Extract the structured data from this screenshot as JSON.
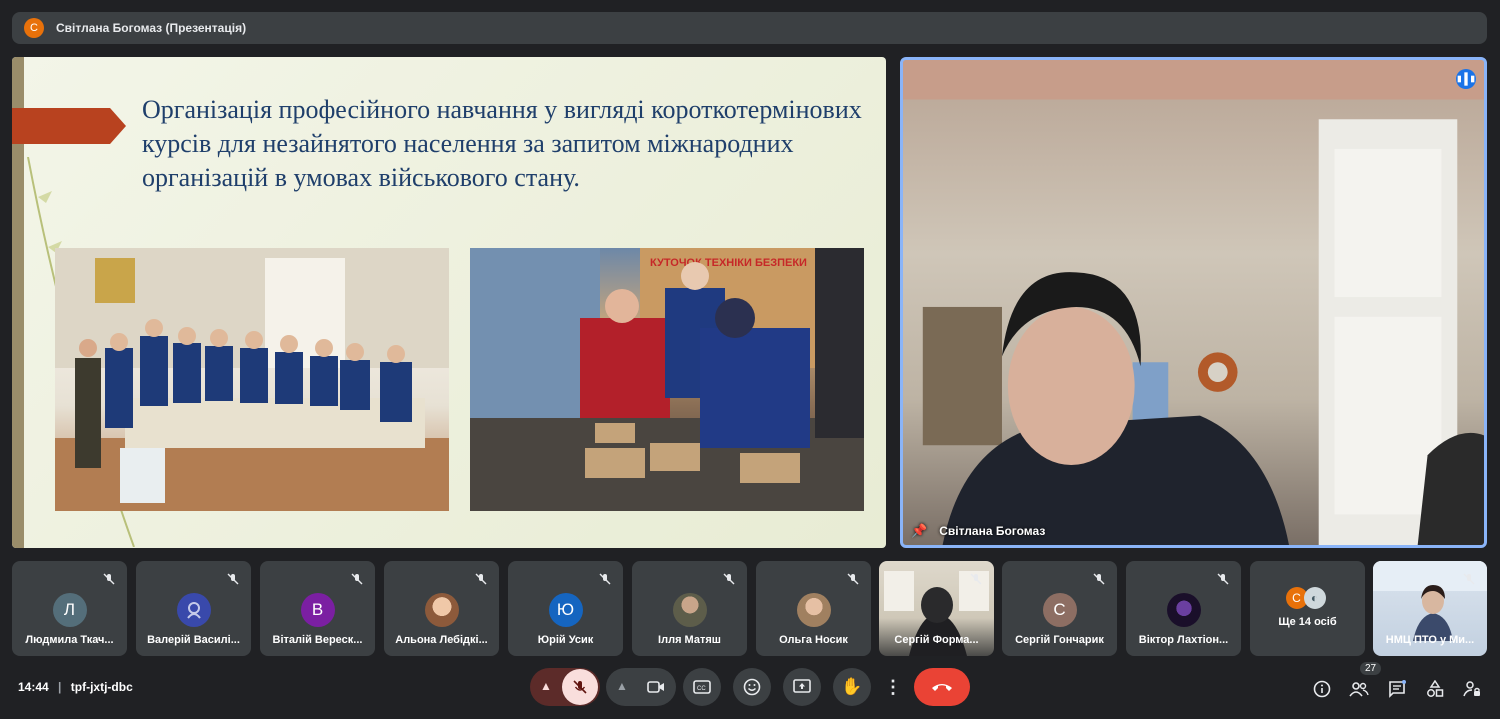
{
  "presenter": {
    "avatar_letter": "С",
    "title": "Світлана Богомаз (Презентація)"
  },
  "slide": {
    "heading": "Організація професійного навчання у вигляді короткотермінових курсів для незайнятого населення за запитом міжнародних організацій в умовах військового стану.",
    "photo2_sign": "КУТОЧОК ТЕХНІКИ БЕЗПЕКИ"
  },
  "camera": {
    "name": "Світлана Богомаз"
  },
  "tiles": [
    {
      "name": "Людмила Ткач...",
      "letter": "Л",
      "color": "#546e7a"
    },
    {
      "name": "Валерій Василі...",
      "letter": "",
      "color": "#3949ab"
    },
    {
      "name": "Віталій Вереск...",
      "letter": "В",
      "color": "#7b1fa2"
    },
    {
      "name": "Альона Лебідкі...",
      "letter": "",
      "color": "#8d5a3b"
    },
    {
      "name": "Юрій Усик",
      "letter": "Ю",
      "color": "#1565c0"
    },
    {
      "name": "Ілля Матяш",
      "letter": "",
      "color": "#6d6d5a"
    },
    {
      "name": "Ольга Носик",
      "letter": "",
      "color": "#a08060"
    },
    {
      "name": "Сергій Форма...",
      "letter": "",
      "color": "#444"
    },
    {
      "name": "Сергій Гончарик",
      "letter": "С",
      "color": "#8d6e63"
    },
    {
      "name": "Віктор Лахтіон...",
      "letter": "",
      "color": "#311b4a"
    },
    {
      "name": "Ще 14 осіб",
      "letter": "С",
      "color": "#e8710a"
    },
    {
      "name": "НМЦ ПТО у Ми...",
      "letter": "",
      "color": "#9fb2c8"
    }
  ],
  "meeting": {
    "time": "14:44",
    "code": "tpf-jxtj-dbc",
    "participants_count": "27"
  },
  "colors": {
    "accent": "#8ab4f8",
    "end_call": "#ea4335",
    "mic_off": "#f9dedc"
  }
}
